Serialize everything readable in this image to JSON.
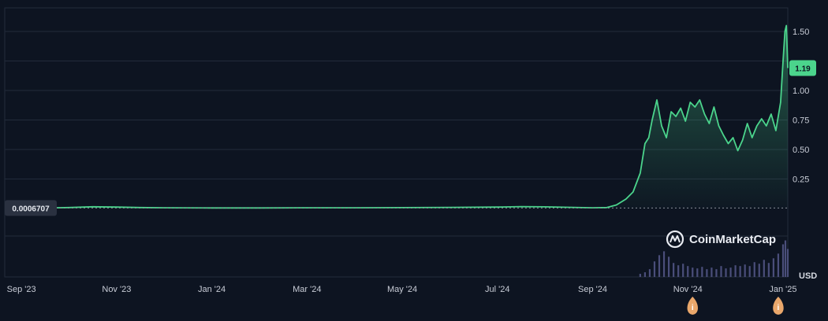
{
  "chart_data": {
    "type": "area",
    "unit": "USD",
    "y_ticks": [
      "1.50",
      "1.00",
      "0.75",
      "0.50",
      "0.25"
    ],
    "y_tick_values": [
      1.5,
      1.0,
      0.75,
      0.5,
      0.25
    ],
    "x_ticks": [
      "Sep '23",
      "Nov '23",
      "Jan '24",
      "Mar '24",
      "May '24",
      "Jul '24",
      "Sep '24",
      "Nov '24",
      "Jan '25"
    ],
    "x_tick_values": [
      0,
      2,
      4,
      6,
      8,
      10,
      12,
      14,
      16
    ],
    "ylim": [
      0,
      1.7
    ],
    "xlim": [
      -0.35,
      16.1
    ],
    "current_price_label": "1.19",
    "start_price_label": "0.0006707",
    "grid": true,
    "colors": {
      "line": "#4bd48c",
      "badge": "#4bd48c",
      "volume": "#4a4e7a",
      "event_marker": "#e9a76b",
      "background": "#0d1421"
    },
    "series": [
      {
        "values": [
          [
            -0.35,
            0.001
          ],
          [
            0.5,
            0.004
          ],
          [
            1.0,
            0.008
          ],
          [
            1.5,
            0.015
          ],
          [
            2.0,
            0.012
          ],
          [
            2.5,
            0.008
          ],
          [
            3.0,
            0.006
          ],
          [
            4.0,
            0.005
          ],
          [
            5.0,
            0.005
          ],
          [
            6.0,
            0.006
          ],
          [
            7.0,
            0.006
          ],
          [
            8.0,
            0.007
          ],
          [
            9.0,
            0.009
          ],
          [
            10.0,
            0.012
          ],
          [
            10.5,
            0.016
          ],
          [
            11.0,
            0.014
          ],
          [
            11.5,
            0.01
          ],
          [
            12.0,
            0.006
          ],
          [
            12.3,
            0.008
          ],
          [
            12.5,
            0.03
          ],
          [
            12.7,
            0.08
          ],
          [
            12.85,
            0.14
          ],
          [
            13.0,
            0.3
          ],
          [
            13.1,
            0.55
          ],
          [
            13.18,
            0.6
          ],
          [
            13.25,
            0.75
          ],
          [
            13.35,
            0.92
          ],
          [
            13.45,
            0.7
          ],
          [
            13.55,
            0.6
          ],
          [
            13.65,
            0.82
          ],
          [
            13.75,
            0.78
          ],
          [
            13.85,
            0.85
          ],
          [
            13.95,
            0.74
          ],
          [
            14.05,
            0.9
          ],
          [
            14.15,
            0.86
          ],
          [
            14.25,
            0.92
          ],
          [
            14.35,
            0.8
          ],
          [
            14.45,
            0.72
          ],
          [
            14.55,
            0.86
          ],
          [
            14.65,
            0.7
          ],
          [
            14.75,
            0.62
          ],
          [
            14.85,
            0.55
          ],
          [
            14.95,
            0.6
          ],
          [
            15.05,
            0.49
          ],
          [
            15.15,
            0.58
          ],
          [
            15.25,
            0.72
          ],
          [
            15.35,
            0.6
          ],
          [
            15.45,
            0.7
          ],
          [
            15.55,
            0.76
          ],
          [
            15.65,
            0.7
          ],
          [
            15.75,
            0.8
          ],
          [
            15.85,
            0.66
          ],
          [
            15.95,
            0.9
          ],
          [
            16.0,
            1.25
          ],
          [
            16.04,
            1.5
          ],
          [
            16.07,
            1.55
          ],
          [
            16.1,
            1.19
          ]
        ]
      }
    ],
    "volume": [
      [
        13.0,
        0.04
      ],
      [
        13.1,
        0.06
      ],
      [
        13.2,
        0.1
      ],
      [
        13.3,
        0.2
      ],
      [
        13.4,
        0.28
      ],
      [
        13.5,
        0.33
      ],
      [
        13.6,
        0.26
      ],
      [
        13.7,
        0.18
      ],
      [
        13.8,
        0.15
      ],
      [
        13.9,
        0.17
      ],
      [
        14.0,
        0.14
      ],
      [
        14.1,
        0.12
      ],
      [
        14.2,
        0.11
      ],
      [
        14.3,
        0.13
      ],
      [
        14.4,
        0.1
      ],
      [
        14.5,
        0.12
      ],
      [
        14.6,
        0.1
      ],
      [
        14.7,
        0.14
      ],
      [
        14.8,
        0.11
      ],
      [
        14.9,
        0.12
      ],
      [
        15.0,
        0.15
      ],
      [
        15.1,
        0.14
      ],
      [
        15.2,
        0.16
      ],
      [
        15.3,
        0.14
      ],
      [
        15.4,
        0.19
      ],
      [
        15.5,
        0.17
      ],
      [
        15.6,
        0.22
      ],
      [
        15.7,
        0.18
      ],
      [
        15.8,
        0.24
      ],
      [
        15.9,
        0.3
      ],
      [
        16.0,
        0.42
      ],
      [
        16.05,
        0.47
      ],
      [
        16.1,
        0.36
      ]
    ],
    "event_markers": [
      {
        "x": 14.1,
        "label": "i"
      },
      {
        "x": 15.9,
        "label": "i"
      }
    ]
  },
  "watermark": {
    "brand": "CoinMarketCap",
    "icon": "coinmarketcap-logo"
  }
}
